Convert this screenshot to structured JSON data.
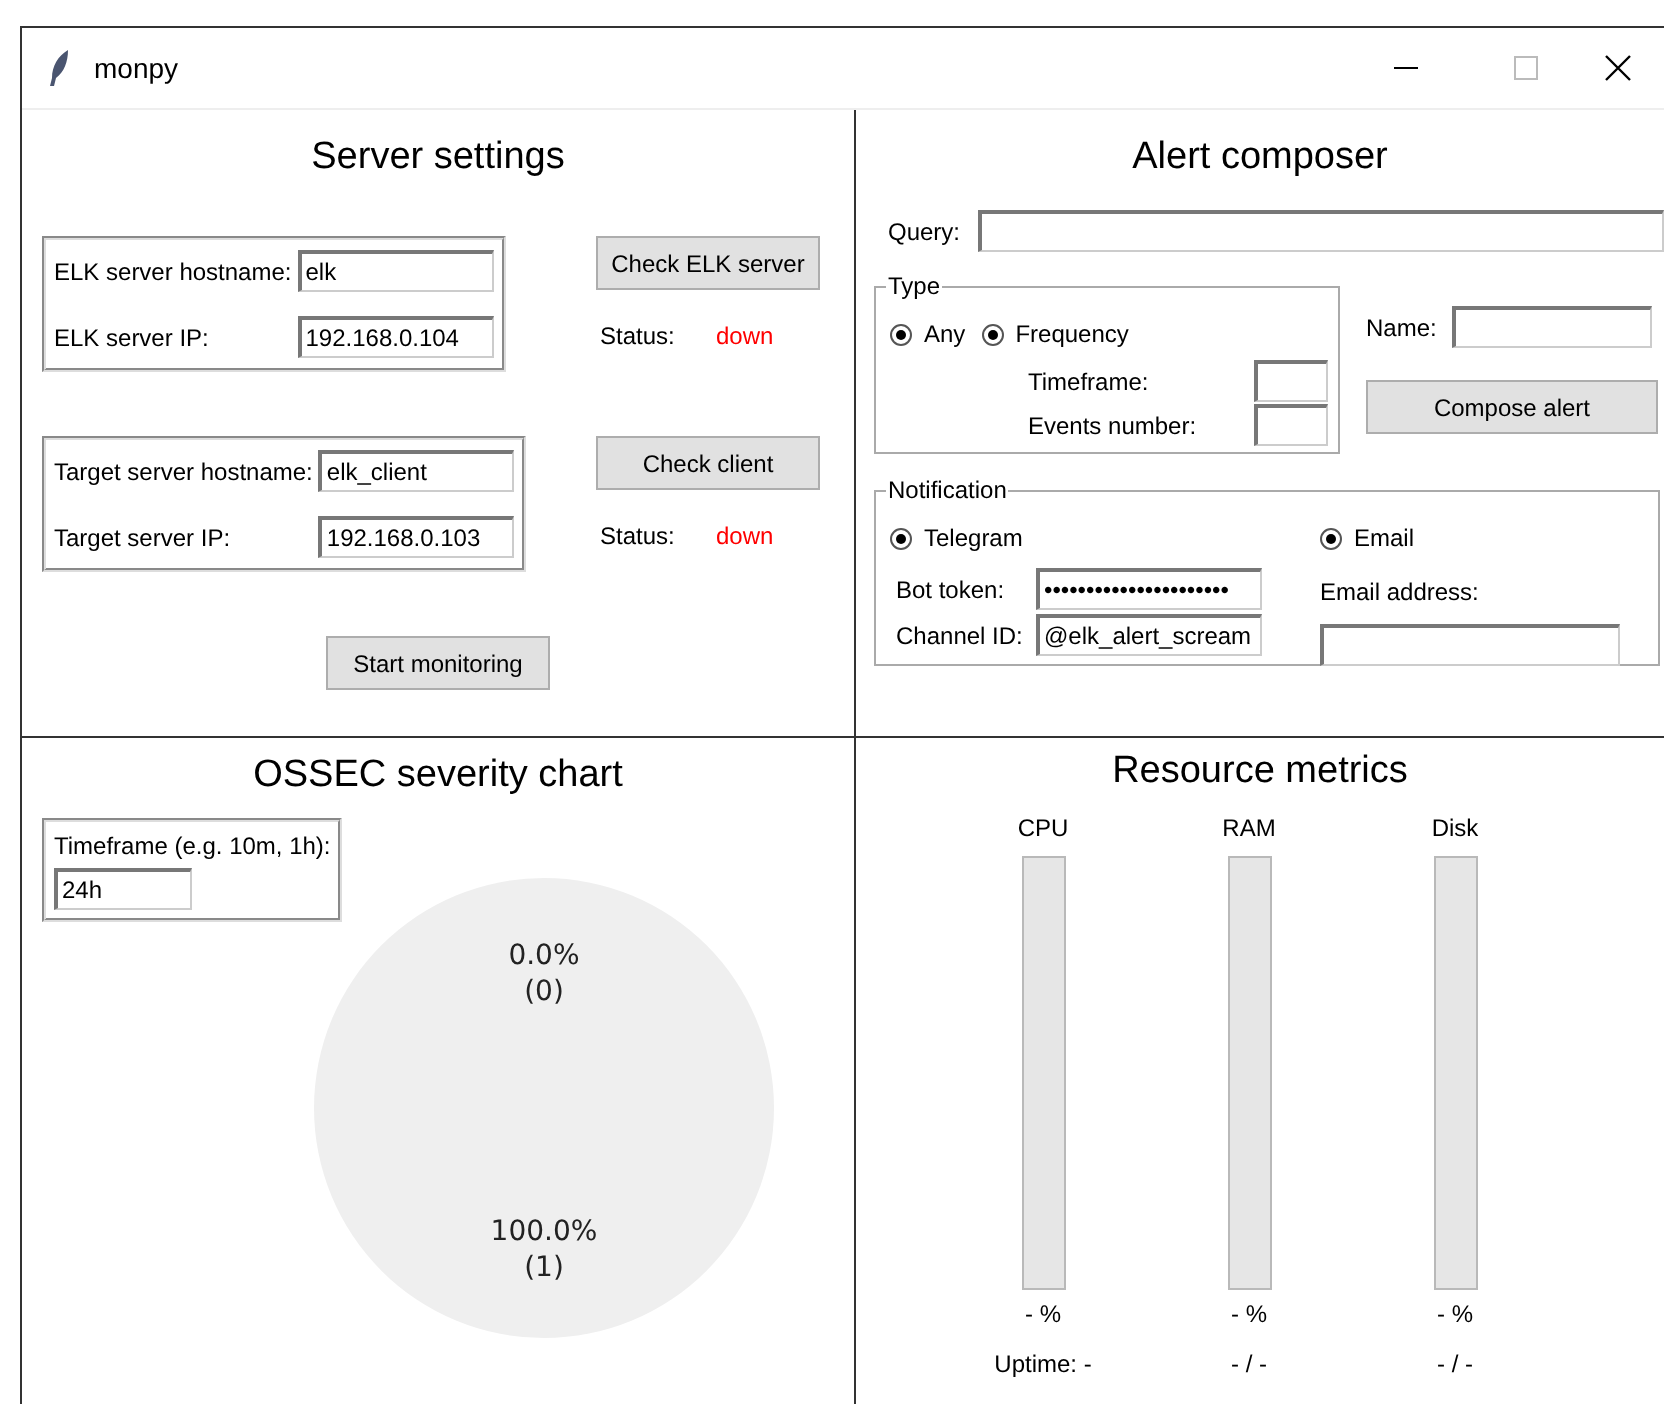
{
  "window": {
    "title": "monpy"
  },
  "server_settings": {
    "title": "Server settings",
    "servers": [
      {
        "fields": [
          {
            "label": "ELK server hostname:",
            "value": "elk"
          },
          {
            "label": "ELK server IP:",
            "value": "192.168.0.104"
          }
        ],
        "button": "Check ELK server",
        "status_label": "Status:",
        "status": "down",
        "up": false
      },
      {
        "fields": [
          {
            "label": "Target server hostname:",
            "value": "elk_client"
          },
          {
            "label": "Target server IP:",
            "value": "192.168.0.103"
          }
        ],
        "button": "Check client",
        "status_label": "Status:",
        "status": "down",
        "up": false
      }
    ],
    "start_button": "Start monitoring"
  },
  "alert_composer": {
    "title": "Alert composer",
    "query": {
      "label": "Query:"
    },
    "type": {
      "legend": "Type",
      "options": [
        {
          "label": "Any",
          "selected": true
        },
        {
          "label": "Frequency",
          "selected": true
        }
      ],
      "fields": [
        {
          "label": "Timeframe:"
        },
        {
          "label": "Events number:"
        }
      ]
    },
    "name": {
      "label": "Name:"
    },
    "button": "Compose alert",
    "notification": {
      "legend": "Notification",
      "channels": [
        {
          "label": "Telegram",
          "selected": true,
          "kind": "inline",
          "fields": [
            {
              "label": "Bot token:",
              "value": "••••••••••••••••••••••"
            },
            {
              "label": "Channel ID:",
              "value": "@elk_alert_scream"
            }
          ]
        },
        {
          "label": "Email",
          "selected": true,
          "kind": "stacked",
          "fields": [
            {
              "label": "Email address:"
            }
          ]
        }
      ]
    }
  },
  "severity_chart": {
    "title": "OSSEC severity chart",
    "timeframe": {
      "label": "Timeframe (e.g. 10m, 1h):",
      "value": "24h"
    },
    "chart_data": {
      "type": "pie",
      "values": [
        0,
        1
      ],
      "value_labels": [
        "0.0%\n(0)",
        "100.0%\n(1)"
      ]
    }
  },
  "resource_metrics": {
    "title": "Resource metrics",
    "meters": [
      {
        "label": "CPU",
        "level": 0,
        "reading": "- %",
        "footer": "Uptime: -"
      },
      {
        "label": "RAM",
        "level": 0,
        "reading": "- %",
        "footer": "- / -"
      },
      {
        "label": "Disk",
        "level": 0,
        "reading": "- %",
        "footer": "- / -"
      }
    ]
  }
}
